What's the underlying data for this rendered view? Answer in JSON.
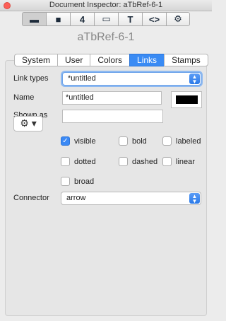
{
  "window": {
    "title": "Document Inspector: aTbRef-6-1"
  },
  "toolbar": {
    "buttons": [
      {
        "icon": "document-icon",
        "glyph": "▬"
      },
      {
        "icon": "note-icon",
        "glyph": "■"
      },
      {
        "icon": "attribute-icon",
        "glyph": "4"
      },
      {
        "icon": "page-icon",
        "glyph": "▭"
      },
      {
        "icon": "text-icon",
        "glyph": "T"
      },
      {
        "icon": "code-icon",
        "glyph": "<>"
      },
      {
        "icon": "gear-icon",
        "glyph": "⚙"
      }
    ]
  },
  "document": {
    "name": "aTbRef-6-1"
  },
  "tabs": [
    {
      "label": "System",
      "active": false
    },
    {
      "label": "User",
      "active": false
    },
    {
      "label": "Colors",
      "active": false
    },
    {
      "label": "Links",
      "active": true
    },
    {
      "label": "Stamps",
      "active": false
    }
  ],
  "link_types": {
    "label": "Link types",
    "value": "*untitled"
  },
  "name": {
    "label": "Name",
    "value": "*untitled",
    "color": "#000000"
  },
  "shown_as": {
    "label": "Shown as",
    "value": ""
  },
  "action_menu": {
    "icon": "gear-icon",
    "glyph": "⚙ ▾"
  },
  "options": [
    {
      "label": "visible",
      "checked": true
    },
    {
      "label": "bold",
      "checked": false
    },
    {
      "label": "labeled",
      "checked": false
    },
    {
      "label": "dotted",
      "checked": false
    },
    {
      "label": "dashed",
      "checked": false
    },
    {
      "label": "linear",
      "checked": false
    },
    {
      "label": "broad",
      "checked": false
    }
  ],
  "connector": {
    "label": "Connector",
    "value": "arrow"
  }
}
